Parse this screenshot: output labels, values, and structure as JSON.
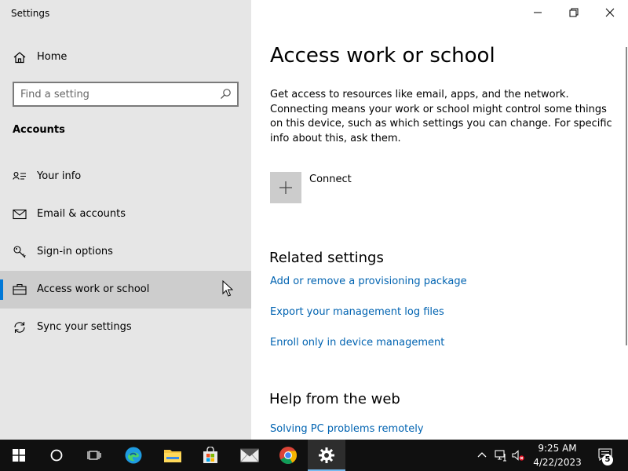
{
  "window": {
    "title": "Settings"
  },
  "sidebar": {
    "home_label": "Home",
    "search_placeholder": "Find a setting",
    "section_title": "Accounts",
    "items": [
      {
        "label": "Your info",
        "icon": "person-card-icon"
      },
      {
        "label": "Email & accounts",
        "icon": "mail-icon"
      },
      {
        "label": "Sign-in options",
        "icon": "key-icon"
      },
      {
        "label": "Access work or school",
        "icon": "briefcase-icon",
        "selected": true
      },
      {
        "label": "Sync your settings",
        "icon": "sync-icon"
      }
    ]
  },
  "main": {
    "title": "Access work or school",
    "description": "Get access to resources like email, apps, and the network. Connecting means your work or school might control some things on this device, such as which settings you can change. For specific info about this, ask them.",
    "connect_label": "Connect",
    "related_title": "Related settings",
    "related_links": [
      "Add or remove a provisioning package",
      "Export your management log files",
      "Enroll only in device management"
    ],
    "help_title": "Help from the web",
    "help_links": [
      "Solving PC problems remotely"
    ]
  },
  "taskbar": {
    "time": "9:25 AM",
    "date": "4/22/2023",
    "notification_count": "5",
    "accent_color": "#0078d7",
    "link_color": "#0063b1"
  }
}
